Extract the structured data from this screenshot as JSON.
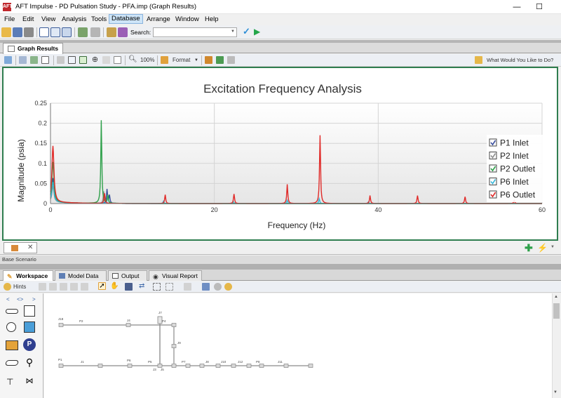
{
  "window": {
    "title": "AFT Impulse - PD Pulsation Study - PFA.imp (Graph Results)",
    "logo_text": "AFT",
    "minimize_glyph": "—",
    "maximize_glyph": "☐"
  },
  "menu": [
    "File",
    "Edit",
    "View",
    "Analysis",
    "Tools",
    "Database",
    "Arrange",
    "Window",
    "Help"
  ],
  "menu_active": "Database",
  "toolbar": {
    "search_label": "Search:",
    "search_value": ""
  },
  "graph_tab": {
    "label": "Graph Results"
  },
  "graph_toolbar": {
    "zoom_label": "100%",
    "format_label": "Format",
    "help_label": "What Would You Like to Do?"
  },
  "chart_data": {
    "type": "line",
    "title": "Excitation Frequency Analysis",
    "xlabel": "Frequency (Hz)",
    "ylabel": "Magnitude (psia)",
    "xlim": [
      0,
      60
    ],
    "ylim": [
      0,
      0.25
    ],
    "xticks": [
      "0",
      "20",
      "40",
      "60"
    ],
    "yticks": [
      "0",
      "0.05",
      "0.1",
      "0.15",
      "0.2",
      "0.25"
    ],
    "grid": true,
    "legend_position": "right",
    "series": [
      {
        "name": "P1 Inlet",
        "color": "#3b4f9e",
        "peaks": [
          [
            0.3,
            0.06
          ],
          [
            6.9,
            0.035
          ],
          [
            7.2,
            0.02
          ]
        ]
      },
      {
        "name": "P2 Inlet",
        "color": "#8c8c8c",
        "peaks": [
          [
            0.3,
            0.04
          ],
          [
            6.5,
            0.03
          ]
        ]
      },
      {
        "name": "P2 Outlet",
        "color": "#2ea04a",
        "peaks": [
          [
            0.3,
            0.1
          ],
          [
            6.2,
            0.207
          ],
          [
            7.0,
            0.02
          ]
        ]
      },
      {
        "name": "P6 Inlet",
        "color": "#39b6d8",
        "peaks": [
          [
            0.3,
            0.05
          ],
          [
            7.0,
            0.02
          ],
          [
            13.8,
            0.006
          ],
          [
            22.3,
            0.006
          ],
          [
            28.9,
            0.008
          ],
          [
            32.8,
            0.012
          ],
          [
            38.8,
            0.004
          ]
        ]
      },
      {
        "name": "P6 Outlet",
        "color": "#e02a28",
        "peaks": [
          [
            0.3,
            0.14
          ],
          [
            6.6,
            0.025
          ],
          [
            14.0,
            0.022
          ],
          [
            22.4,
            0.024
          ],
          [
            28.9,
            0.048
          ],
          [
            32.9,
            0.17
          ],
          [
            39.0,
            0.02
          ],
          [
            44.8,
            0.02
          ],
          [
            50.6,
            0.017
          ],
          [
            56.6,
            0.008
          ]
        ]
      }
    ]
  },
  "scenario_label": "Base Scenario",
  "bottom_tabs": [
    "Workspace",
    "Model Data",
    "Output",
    "Visual Report"
  ],
  "workspace_toolbar": {
    "hints_label": "Hints"
  },
  "palette_nav": [
    "<",
    "<>",
    ">"
  ],
  "model": {
    "labels": [
      "J18",
      "P2",
      "J4",
      "P4",
      "J7",
      "J9",
      "P1",
      "J1",
      "P6",
      "P5",
      "J3",
      "P7",
      "J5",
      "J8",
      "J10",
      "J12",
      "P8",
      "J11"
    ]
  }
}
